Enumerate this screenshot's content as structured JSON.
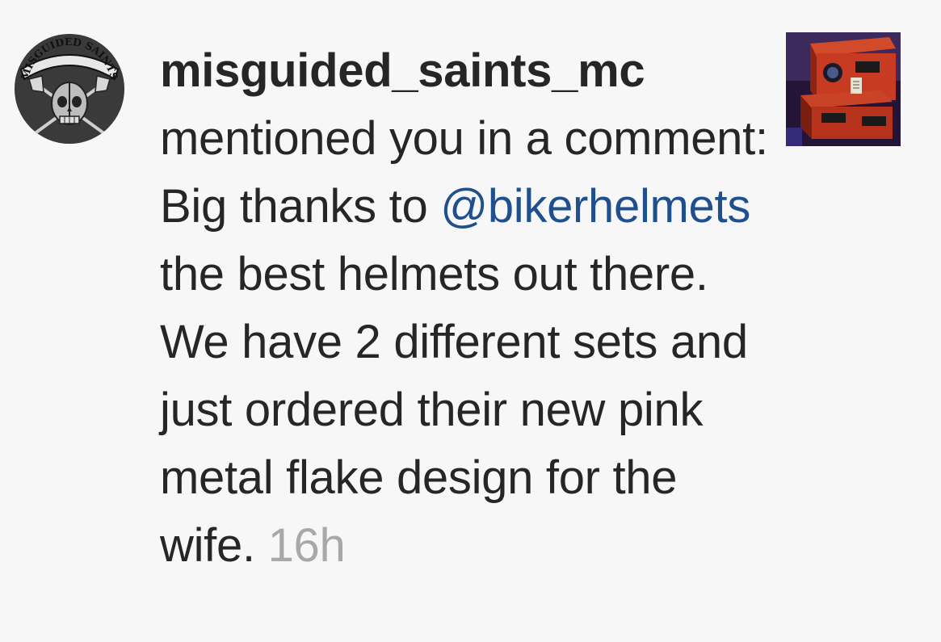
{
  "notification": {
    "avatar": {
      "logo_text": "MISGUIDED SAINTS",
      "icon": "club-logo-skull-axes"
    },
    "username": "misguided_saints_mc",
    "action_text": "mentioned you in a comment:",
    "comment_before_mention": "Big thanks to",
    "mention": "@bikerhelmets",
    "comment_after_mention": "the best helmets out there. We have 2 different sets and just ordered their new pink metal flake design for the wife.",
    "timestamp": "16h",
    "post_thumbnail": {
      "icon": "post-thumbnail-helmet-boxes"
    },
    "colors": {
      "mention": "#1f4f8c",
      "timestamp": "#a8a8a8",
      "text": "#262626",
      "background": "#f7f7f7"
    }
  }
}
